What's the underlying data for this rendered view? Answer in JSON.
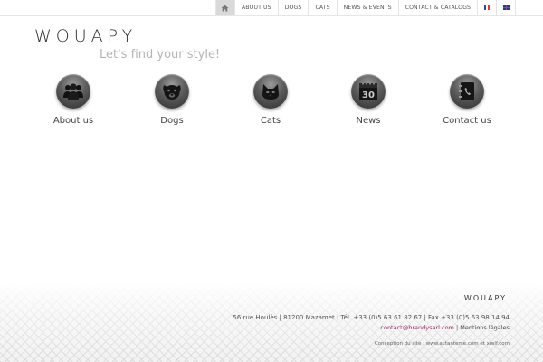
{
  "topnav": {
    "home_icon": "home-icon",
    "items": [
      {
        "label": "ABOUT US"
      },
      {
        "label": "DOGS"
      },
      {
        "label": "CATS"
      },
      {
        "label": "NEWS & EVENTS"
      },
      {
        "label": "CONTACT & CATALOGS"
      }
    ],
    "languages": [
      "fr-flag-icon",
      "uk-flag-icon"
    ]
  },
  "header": {
    "logo": "WOUAPY",
    "tagline": "Let's find your style!"
  },
  "tiles": [
    {
      "label": "About us",
      "icon": "people-icon"
    },
    {
      "label": "Dogs",
      "icon": "dog-icon"
    },
    {
      "label": "Cats",
      "icon": "cat-icon"
    },
    {
      "label": "News",
      "icon": "calendar-icon"
    },
    {
      "label": "Contact us",
      "icon": "address-book-icon"
    }
  ],
  "calendar_day": "30",
  "footer": {
    "logo": "WOUAPY",
    "address": "56 rue Houlès  |  81200 Mazamet  |  Tél. +33 (0)5 63 61 82 67  |  Fax +33 (0)5 63 98 14 94",
    "email": "contact@brandysarl.com",
    "separator": "|",
    "legal": "Mentions légales",
    "credit": "Conception du site : www.actanteme.com et xrelf.com"
  },
  "colors": {
    "accent_link": "#a3245c",
    "home_tab_bg": "#d9d9d9"
  }
}
